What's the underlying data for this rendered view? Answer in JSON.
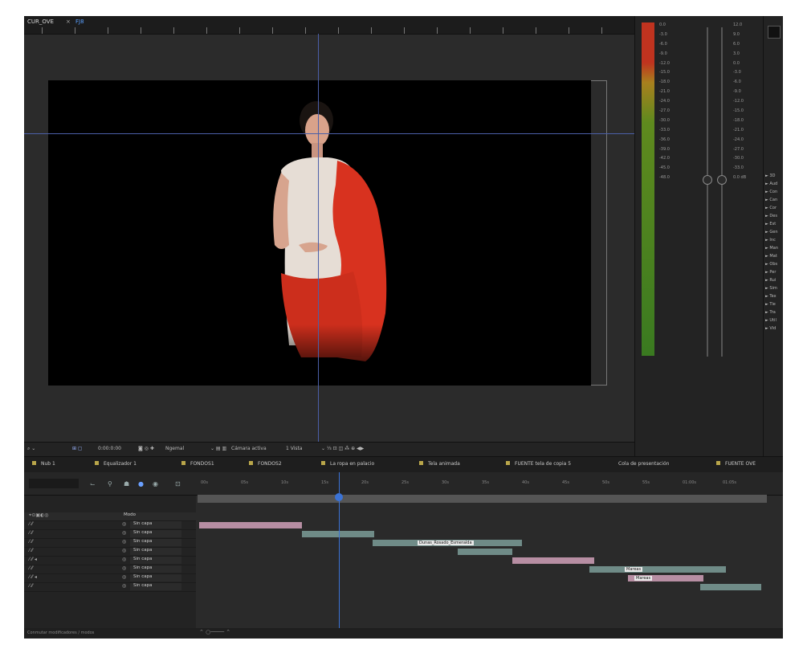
{
  "viewer": {
    "tab_name": "CUR_OVE",
    "tab_close": "×",
    "tab_number": "FJ8",
    "ruler_labels": [
      "",
      "",
      "",
      "",
      "",
      "",
      "",
      "",
      "",
      "",
      "",
      "",
      "",
      "",
      "",
      "",
      "",
      ""
    ],
    "toolbar": {
      "zoom": "",
      "timecode": "0:00:0:00",
      "quality": "Ngemal",
      "view": "1 Vista",
      "camera": "Cámara activa"
    }
  },
  "audio": {
    "db_left": [
      "0.0",
      "-3.0",
      "-6.0",
      "-9.0",
      "-12.0",
      "-15.0",
      "-18.0",
      "-21.0",
      "-24.0",
      "-27.0",
      "-30.0",
      "-33.0",
      "-36.0",
      "-39.0",
      "-42.0",
      "-45.0",
      "-48.0"
    ],
    "db_right": [
      "12.0",
      "9.0",
      "6.0",
      "3.0",
      "0.0",
      "-3.0",
      "-6.0",
      "-9.0",
      "-12.0",
      "-15.0",
      "-18.0",
      "-21.0",
      "-24.0",
      "-27.0",
      "-30.0",
      "-33.0",
      "0.0 dB"
    ]
  },
  "effects": {
    "items": [
      "► 3D",
      "► Aud",
      "► Con",
      "► Can",
      "► Cor",
      "► Des",
      "► Est",
      "► Gen",
      "► Inc",
      "► Man",
      "► Mat",
      "► Obs",
      "► Per",
      "► Rui",
      "► Sim",
      "► Tex",
      "► Tie",
      "► Tra",
      "► Util",
      "► Vid"
    ]
  },
  "timeline": {
    "tabs": [
      {
        "label": "Nub 1"
      },
      {
        "label": "Equalizador 1"
      },
      {
        "label": "FONDOS1"
      },
      {
        "label": "FONDOS2"
      },
      {
        "label": "La ropa en palacio"
      },
      {
        "label": "Tela animada"
      },
      {
        "label": "FUENTE tela de copia 5"
      },
      {
        "label": "Cola de presentación"
      },
      {
        "label": "FUENTE OVE"
      }
    ],
    "mode_header": "Modo",
    "rows": [
      {
        "mode": "Sin capa"
      },
      {
        "mode": "Sin capa"
      },
      {
        "mode": "Sin capa"
      },
      {
        "mode": "Sin capa"
      },
      {
        "mode": "Sin capa"
      },
      {
        "mode": "Sin capa"
      },
      {
        "mode": "Sin capa"
      },
      {
        "mode": "Sin capa"
      }
    ],
    "time_labels": [
      "00s",
      "05s",
      "10s",
      "15s",
      "20s",
      "25s",
      "30s",
      "35s",
      "40s",
      "45s",
      "50s",
      "55s",
      "01:00s",
      "01:05s"
    ],
    "clip_labels": [
      "Dunas_Rosado_Esmeralda",
      "Mareas",
      "Mareas"
    ],
    "status_text": "Conmutar modificadores / modos"
  },
  "colors": {
    "accent": "#3b73d6",
    "clip_pink": "#b78ea3",
    "clip_teal": "#6f8b87",
    "background": "#262626"
  }
}
